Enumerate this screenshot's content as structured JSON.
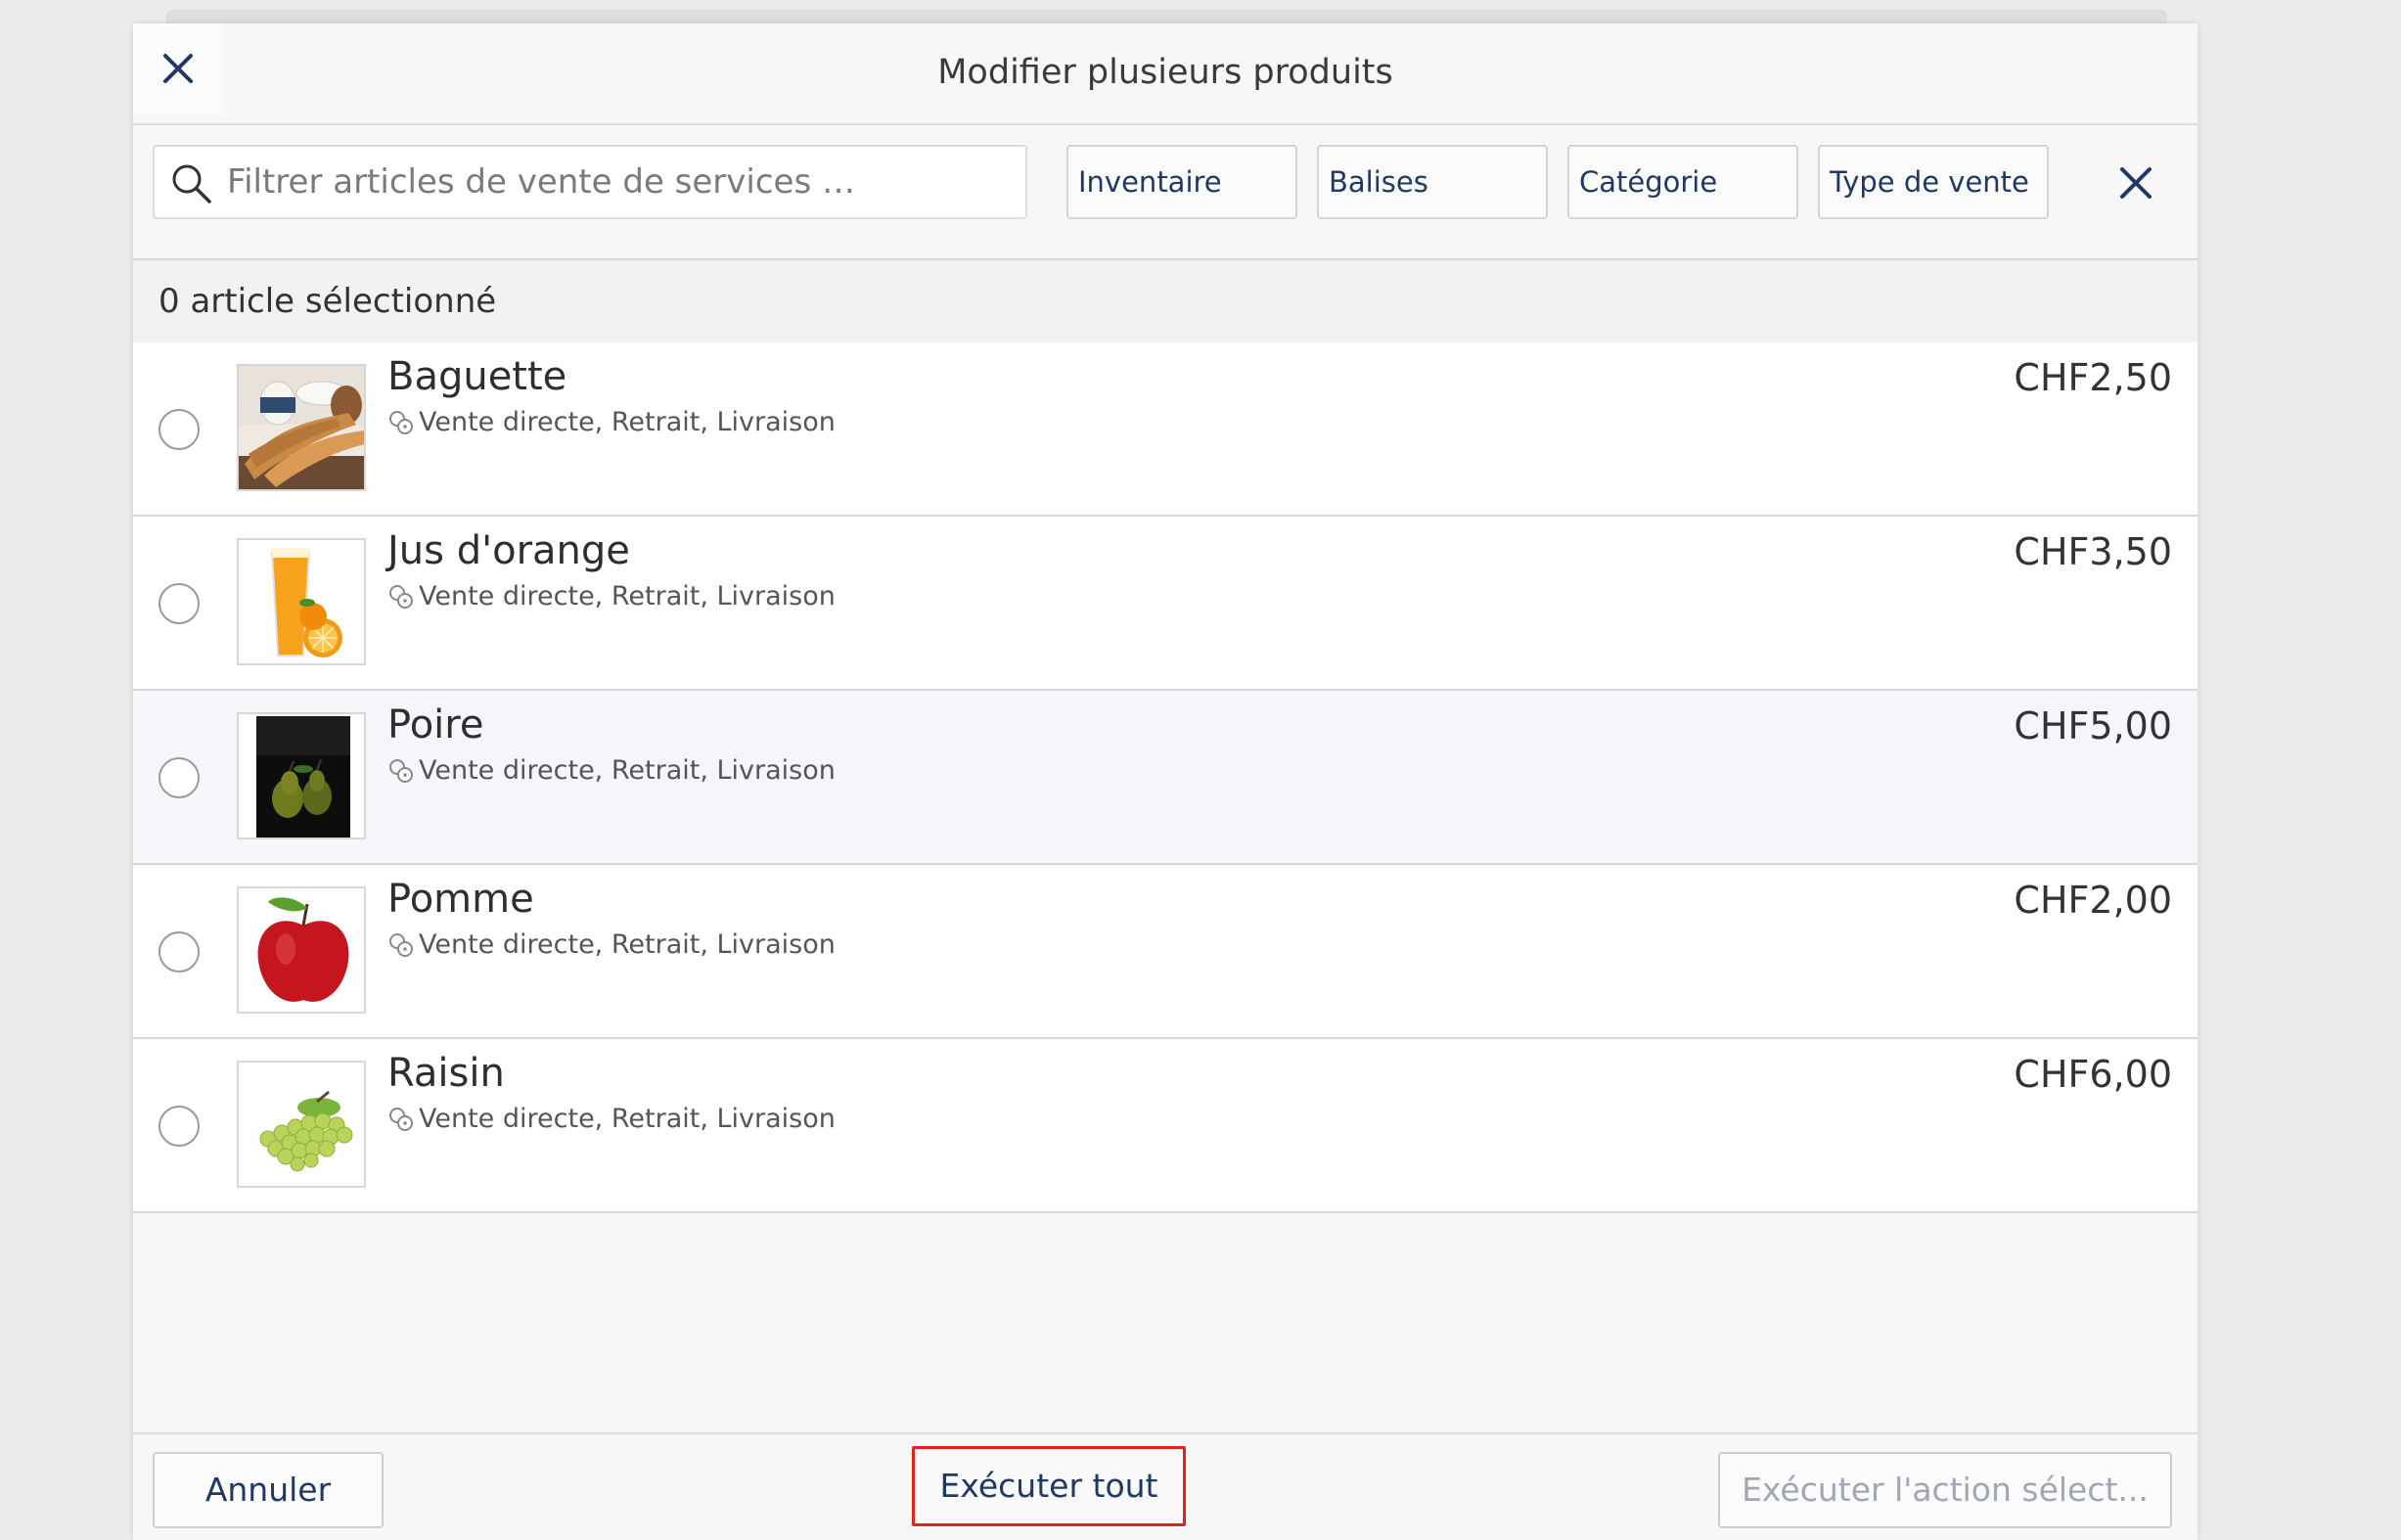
{
  "modal": {
    "title": "Modifier plusieurs produits"
  },
  "filters": {
    "search_placeholder": "Filtrer articles de vente de services …",
    "chips": [
      "Inventaire",
      "Balises",
      "Catégorie",
      "Type de vente"
    ]
  },
  "selection": {
    "summary": "0 article sélectionné"
  },
  "products": [
    {
      "name": "Baguette",
      "meta": "Vente directe, Retrait, Livraison",
      "price": "CHF2,50",
      "image": "baguette-image"
    },
    {
      "name": "Jus d'orange",
      "meta": "Vente directe, Retrait, Livraison",
      "price": "CHF3,50",
      "image": "orange-juice-image"
    },
    {
      "name": "Poire",
      "meta": "Vente directe, Retrait, Livraison",
      "price": "CHF5,00",
      "image": "pear-image"
    },
    {
      "name": "Pomme",
      "meta": "Vente directe, Retrait, Livraison",
      "price": "CHF2,00",
      "image": "apple-image"
    },
    {
      "name": "Raisin",
      "meta": "Vente directe, Retrait, Livraison",
      "price": "CHF6,00",
      "image": "grapes-image"
    }
  ],
  "footer": {
    "cancel_label": "Annuler",
    "run_all_label": "Exécuter tout",
    "run_selected_label": "Exécuter l'action sélect..."
  },
  "colors": {
    "accent": "#1f3864",
    "highlight_border": "#e2231a",
    "disabled_text": "#a0a6b4"
  }
}
